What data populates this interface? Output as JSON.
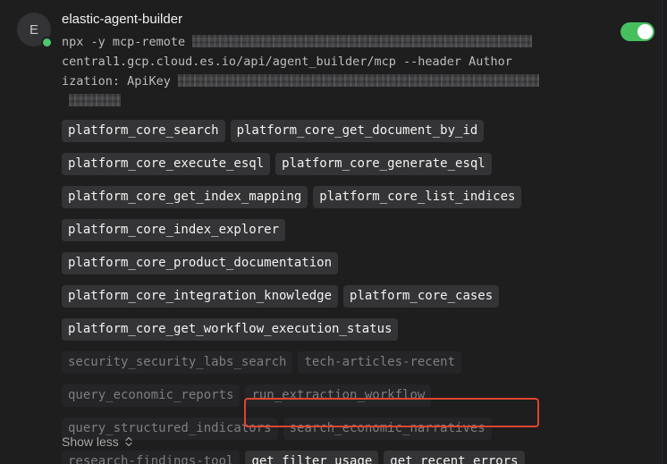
{
  "server": {
    "avatar_letter": "E",
    "name": "elastic-agent-builder",
    "enabled": true,
    "command_lines": [
      "npx -y mcp-remote",
      "central1.gcp.cloud.es.io/api/agent_builder/mcp --header Author",
      "ization: ApiKey"
    ]
  },
  "tools": [
    {
      "name": "platform_core_search",
      "enabled": true
    },
    {
      "name": "platform_core_get_document_by_id",
      "enabled": true
    },
    {
      "name": "platform_core_execute_esql",
      "enabled": true
    },
    {
      "name": "platform_core_generate_esql",
      "enabled": true
    },
    {
      "name": "platform_core_get_index_mapping",
      "enabled": true
    },
    {
      "name": "platform_core_list_indices",
      "enabled": true
    },
    {
      "name": "platform_core_index_explorer",
      "enabled": true
    },
    {
      "name": "platform_core_product_documentation",
      "enabled": true
    },
    {
      "name": "platform_core_integration_knowledge",
      "enabled": true
    },
    {
      "name": "platform_core_cases",
      "enabled": true
    },
    {
      "name": "platform_core_get_workflow_execution_status",
      "enabled": true
    },
    {
      "name": "security_security_labs_search",
      "enabled": false
    },
    {
      "name": "tech-articles-recent",
      "enabled": false
    },
    {
      "name": "query_economic_reports",
      "enabled": false
    },
    {
      "name": "run_extraction_workflow",
      "enabled": false
    },
    {
      "name": "query_structured_indicators",
      "enabled": false
    },
    {
      "name": "search_economic_narratives",
      "enabled": false
    },
    {
      "name": "research-findings-tool",
      "enabled": false
    },
    {
      "name": "get_filter_usage",
      "enabled": true
    },
    {
      "name": "get_recent_errors",
      "enabled": true
    }
  ],
  "footer": {
    "toggle_label": "Show less",
    "icon": "chevron-up-down-icon"
  },
  "colors": {
    "enabled_toggle": "#46c05f",
    "status_dot": "#4ec66f",
    "highlight": "#e0442f"
  }
}
